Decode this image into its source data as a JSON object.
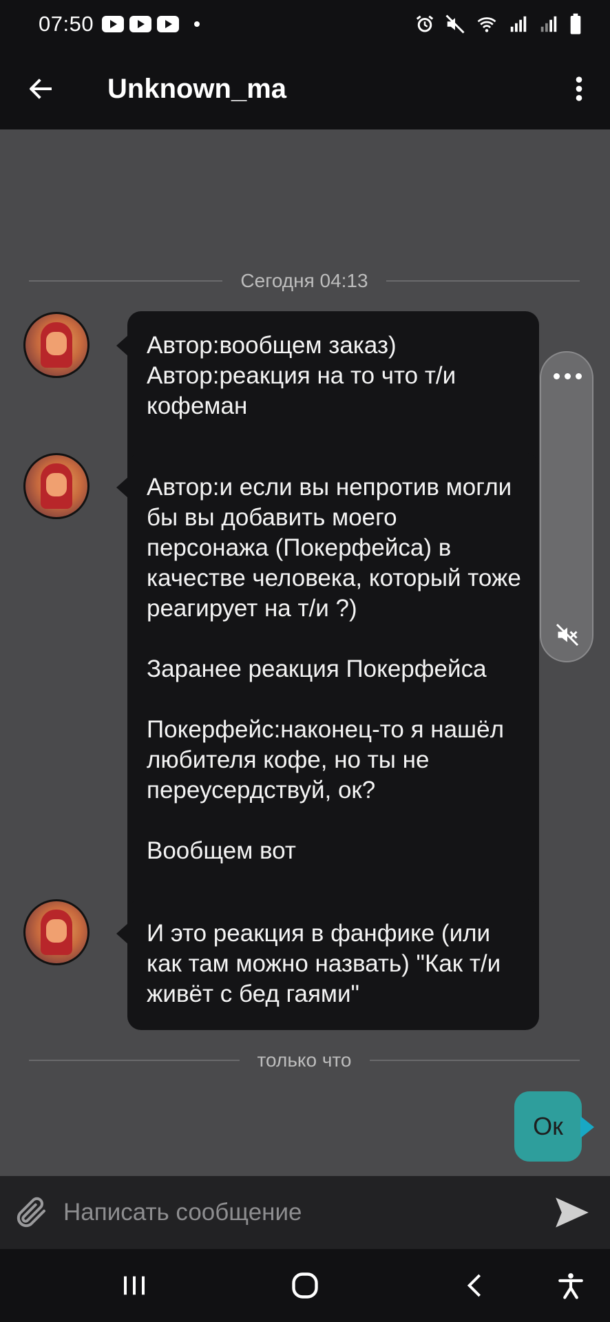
{
  "status_bar": {
    "time": "07:50"
  },
  "header": {
    "title": "Unknown_ma"
  },
  "chat": {
    "date_dividers": [
      "Сегодня 04:13",
      "только что"
    ],
    "incoming_messages": [
      {
        "text": "Автор:вообщем заказ)\nАвтор:реакция на то что т/и кофеман"
      },
      {
        "text": "Автор:и если вы непротив могли бы вы добавить моего персонажа (Покерфейса) в качестве человека, который тоже реагирует на т/и ?)\n\nЗаранее реакция Покерфейса\n\nПокерфейс:наконец-то я нашёл любителя кофе, но ты не переусердствуй, ок?\n\nВообщем вот"
      },
      {
        "text": "И это реакция в фанфике (или как там можно назвать) \"Как т/и живёт с бед гаями\""
      }
    ],
    "outgoing_messages": [
      {
        "text": "Ок"
      }
    ]
  },
  "composer": {
    "placeholder": "Написать сообщение"
  },
  "colors": {
    "chat_background": "#4a4a4c",
    "incoming_bubble": "#141416",
    "outgoing_bubble": "#2e9e9c",
    "bars": "#111113"
  },
  "icons": [
    "youtube-icon",
    "alarm-icon",
    "mute-icon",
    "wifi-icon",
    "signal-icon",
    "battery-icon",
    "back-arrow-icon",
    "more-vert-icon",
    "paperclip-icon",
    "send-icon",
    "recents-icon",
    "home-icon",
    "back-icon",
    "accessibility-icon"
  ]
}
